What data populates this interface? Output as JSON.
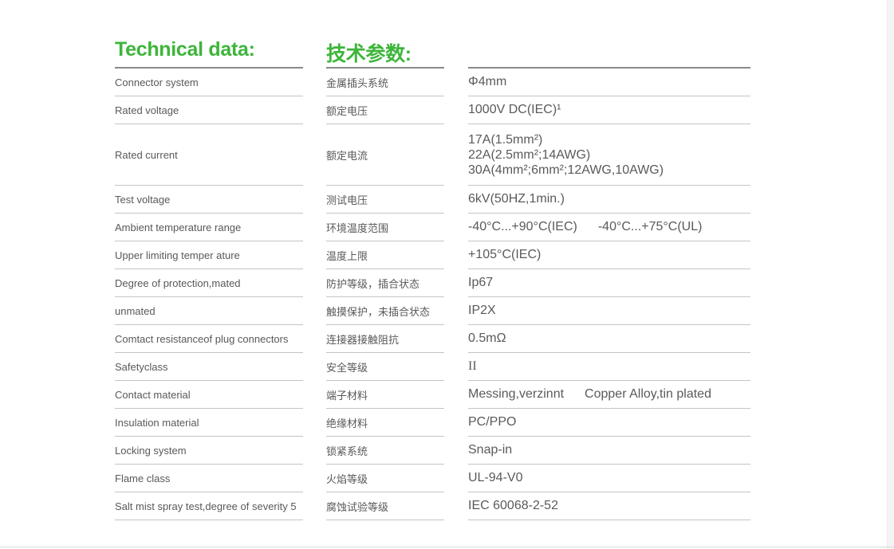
{
  "header": {
    "title_en": "Technical data:",
    "title_cn": "技术参数:"
  },
  "rows": [
    {
      "en": "Connector system",
      "cn": "金属插头系统",
      "value": "Φ4mm"
    },
    {
      "en": "Rated voltage",
      "cn": "额定电压",
      "value": "1000V DC(IEC)¹"
    },
    {
      "en": "Rated current",
      "cn": "额定电流",
      "value_lines": [
        "17A(1.5mm²)",
        "22A(2.5mm²;14AWG)",
        "30A(4mm²;6mm²;12AWG,10AWG)"
      ]
    },
    {
      "en": "Test voltage",
      "cn": "测试电压",
      "value": "6kV(50HZ,1min.)"
    },
    {
      "en": "Ambient temperature range",
      "cn": "环境温度范围",
      "value": "-40°C...+90°C(IEC)",
      "value2": "-40°C...+75°C(UL)"
    },
    {
      "en": "Upper limiting temper ature",
      "cn": "温度上限",
      "value": "+105°C(IEC)"
    },
    {
      "en": "Degree of protection,mated",
      "cn": "防护等级，插合状态",
      "value": "Ip67"
    },
    {
      "en": "unmated",
      "cn": "触摸保护，未插合状态",
      "value": "IP2X"
    },
    {
      "en": "Comtact resistanceof plug connectors",
      "cn": "连接器接触阻抗",
      "value": "0.5mΩ"
    },
    {
      "en": "Safetyclass",
      "cn": "安全等级",
      "value": "II"
    },
    {
      "en": "Contact material",
      "cn": "端子材料",
      "value": "Messing,verzinnt",
      "value2": "Copper Alloy,tin plated"
    },
    {
      "en": "Insulation material",
      "cn": "绝缘材料",
      "value": "PC/PPO"
    },
    {
      "en": "Locking system",
      "cn": "锁紧系统",
      "value": "Snap-in"
    },
    {
      "en": "Flame class",
      "cn": "火焰等级",
      "value": "UL-94-V0"
    },
    {
      "en": "Salt mist spray test,degree of severity 5",
      "cn": "腐蚀试验等级",
      "value": "IEC 60068-2-52"
    }
  ],
  "colors": {
    "accent_green": "#3db53a",
    "text": "#5a5a5a",
    "rule": "#8a8a8a",
    "divider": "#c4c4c4"
  }
}
